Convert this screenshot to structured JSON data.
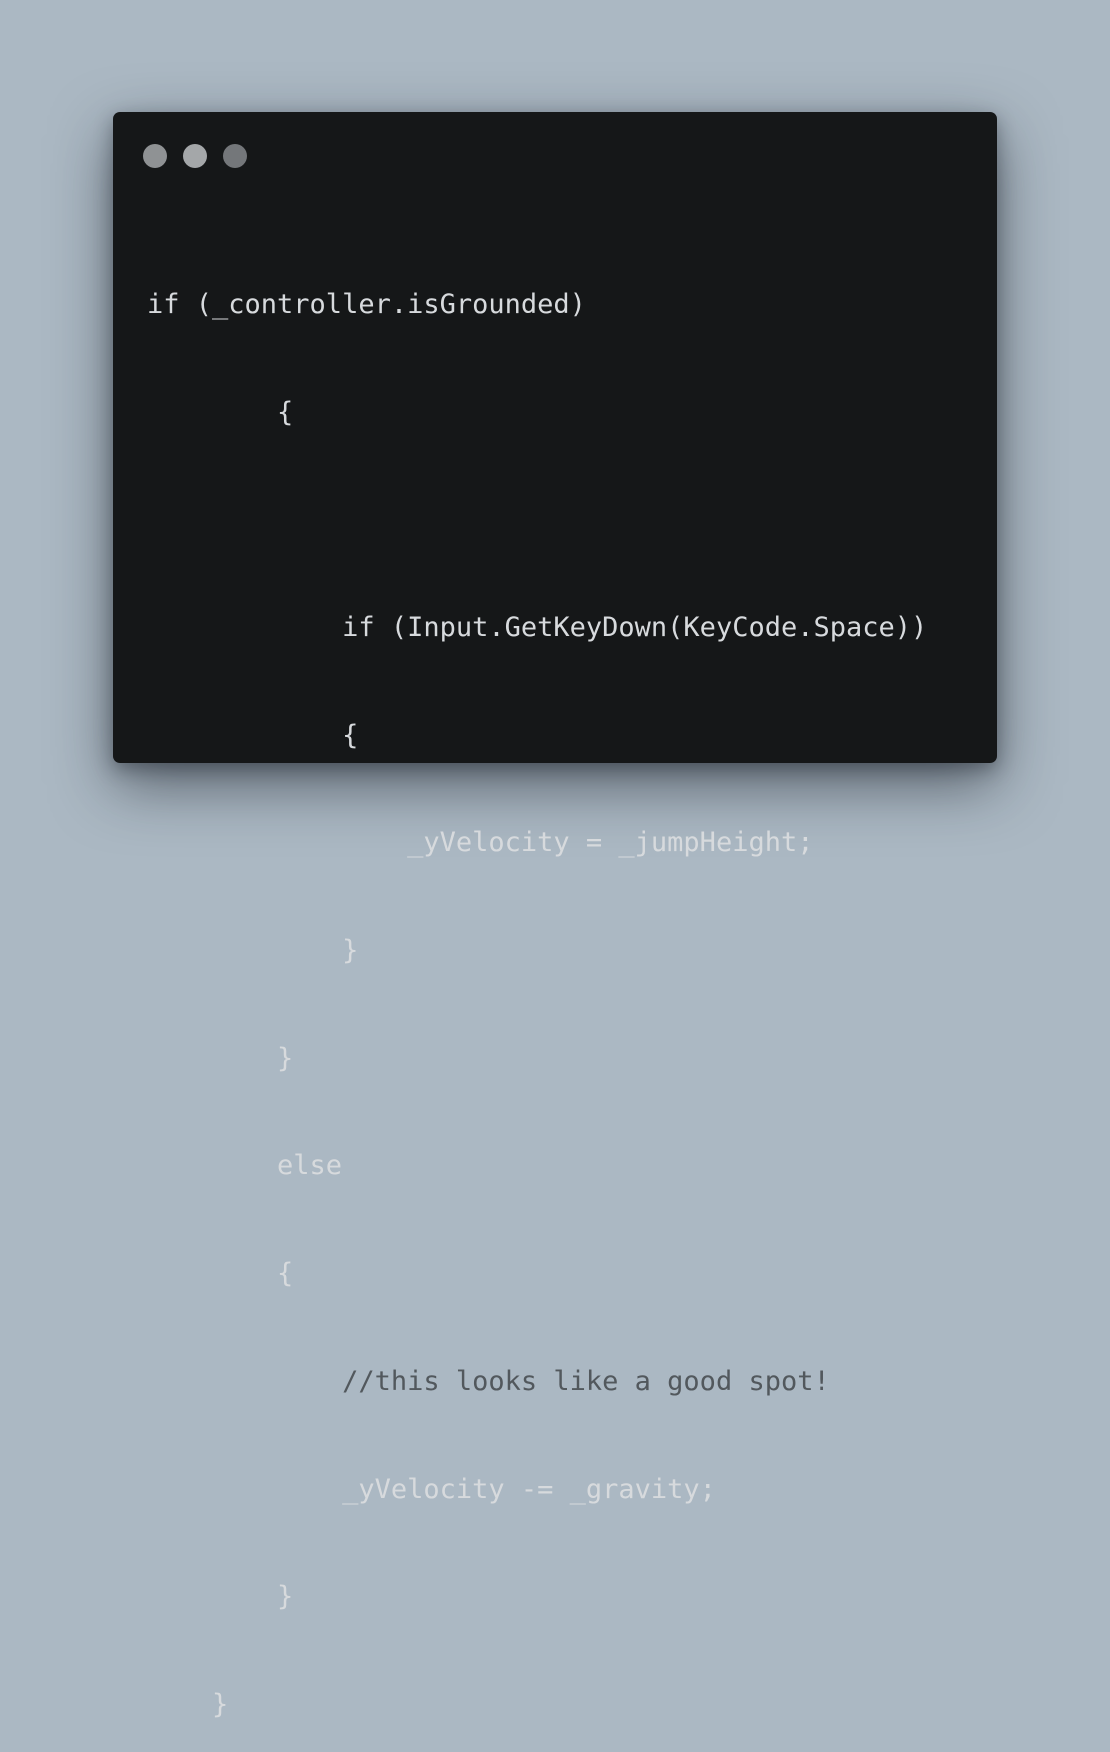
{
  "window": {
    "dots": [
      "close-dot",
      "minimize-dot",
      "maximize-dot"
    ]
  },
  "code": {
    "lines": [
      "if (_controller.isGrounded)",
      "        {",
      "",
      "            if (Input.GetKeyDown(KeyCode.Space))",
      "            {",
      "                _yVelocity = _jumpHeight;",
      "            }",
      "        }",
      "        else",
      "        {",
      "            //this looks like a good spot!",
      "            _yVelocity -= _gravity;",
      "        }",
      "    }"
    ]
  },
  "colors": {
    "background": "#abb8c3",
    "window": "#151718",
    "code_text": "#d7dadd",
    "comment_text": "#52585d"
  }
}
